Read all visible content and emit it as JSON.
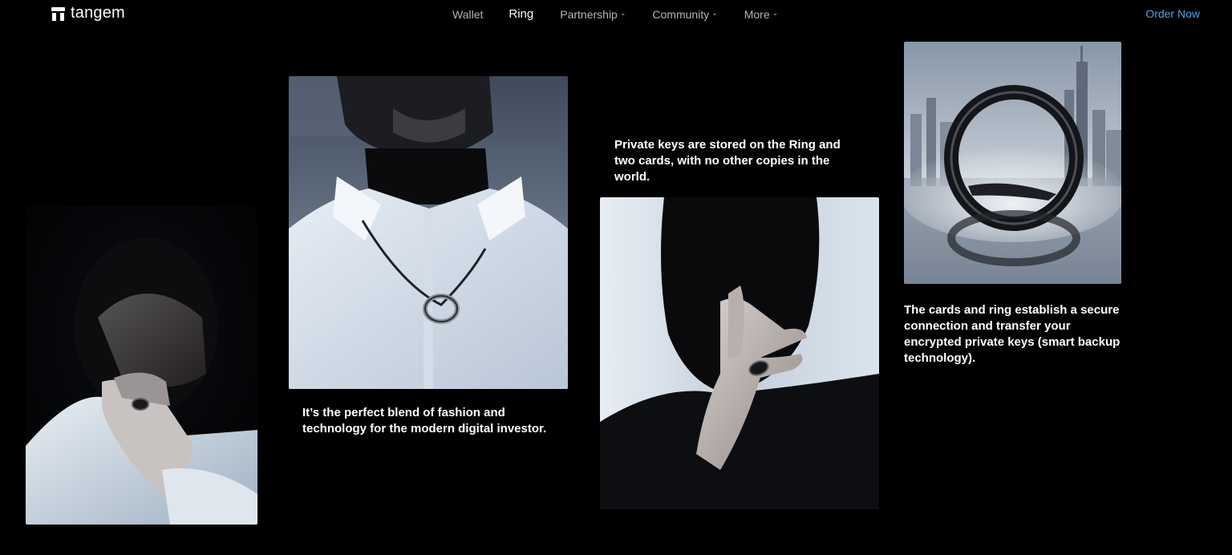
{
  "header": {
    "brand": "tangem",
    "nav": [
      {
        "label": "Wallet",
        "has_dropdown": false
      },
      {
        "label": "Ring",
        "has_dropdown": false,
        "active": true
      },
      {
        "label": "Partnership",
        "has_dropdown": true
      },
      {
        "label": "Community",
        "has_dropdown": true
      },
      {
        "label": "More",
        "has_dropdown": true
      }
    ],
    "cta": "Order Now"
  },
  "captions": {
    "fashion": "It’s the perfect blend of fashion and technology for the modern digital investor.",
    "keys": "Private keys are stored on the Ring and two cards, with no other copies in the world.",
    "backup": "The cards and ring establish a secure connection and transfer your encrypted private keys (smart backup technology)."
  },
  "icons": {
    "chevron": "chevron-down-icon",
    "logo": "tangem-logo-icon"
  },
  "colors": {
    "background": "#000000",
    "accent": "#4ea3e6",
    "nav_text": "#b4b4b4"
  }
}
